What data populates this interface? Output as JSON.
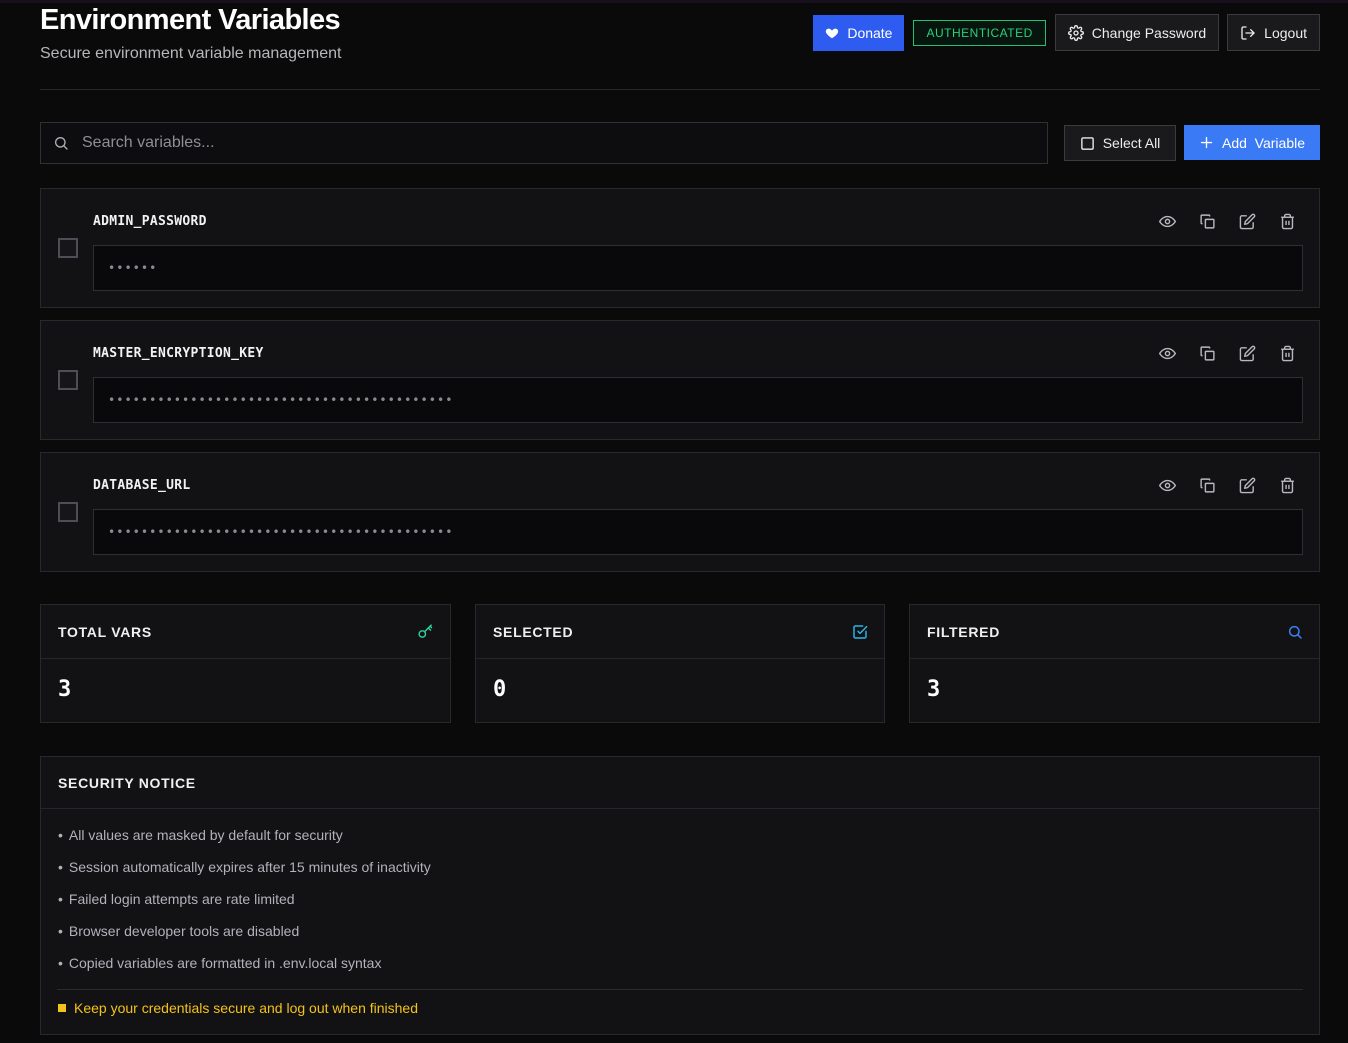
{
  "header": {
    "title": "Environment Variables",
    "subtitle": "Secure environment variable management",
    "donate_label": "Donate",
    "auth_badge": "AUTHENTICATED",
    "change_password_label": "Change Password",
    "logout_label": "Logout"
  },
  "toolbar": {
    "search_placeholder": "Search variables...",
    "search_value": "",
    "select_all_label": "Select All",
    "add_variable_label": "Add  Variable"
  },
  "variables": [
    {
      "name": "ADMIN_PASSWORD",
      "value": "••••••",
      "selected": false
    },
    {
      "name": "MASTER_ENCRYPTION_KEY",
      "value": "••••••••••••••••••••••••••••••••••••••••••",
      "selected": false
    },
    {
      "name": "DATABASE_URL",
      "value": "••••••••••••••••••••••••••••••••••••••••••",
      "selected": false
    }
  ],
  "stats": [
    {
      "label": "TOTAL VARS",
      "value": "3",
      "icon": "key-icon",
      "color": "#2ed39a"
    },
    {
      "label": "SELECTED",
      "value": "0",
      "icon": "check-square-icon",
      "color": "#29b6e8"
    },
    {
      "label": "FILTERED",
      "value": "3",
      "icon": "search-icon",
      "color": "#3b82f6"
    }
  ],
  "security": {
    "title": "SECURITY NOTICE",
    "notices": [
      "All values are masked by default for security",
      "Session automatically expires after 15 minutes of inactivity",
      "Failed login attempts are rate limited",
      "Browser developer tools are disabled",
      "Copied variables are formatted in .env.local syntax"
    ],
    "warning": "Keep your credentials secure and log out when finished"
  },
  "colors": {
    "background": "#0a0a0b",
    "card": "#121214",
    "primary": "#3b7af5",
    "donate": "#2f5cf0",
    "authenticated": "#28d07e",
    "warning": "#f3c21b"
  }
}
